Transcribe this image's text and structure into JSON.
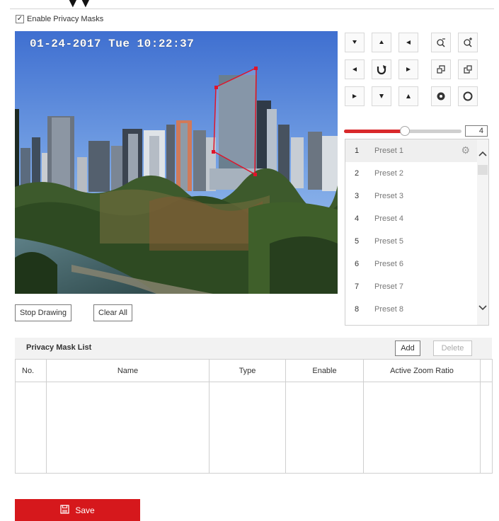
{
  "enable_privacy_masks": {
    "label": "Enable Privacy Masks",
    "checked": true
  },
  "video": {
    "osd_timestamp": "01-24-2017 Tue 10:22:37"
  },
  "ptz": {
    "buttons": [
      {
        "name": "pan-up-left",
        "icon": "arrow-up-left-icon"
      },
      {
        "name": "pan-up",
        "icon": "arrow-up-icon"
      },
      {
        "name": "pan-up-right",
        "icon": "arrow-up-right-icon"
      },
      {
        "name": "pan-left",
        "icon": "arrow-left-icon"
      },
      {
        "name": "auto-pan",
        "icon": "auto-rotate-icon"
      },
      {
        "name": "pan-right",
        "icon": "arrow-right-icon"
      },
      {
        "name": "pan-down-left",
        "icon": "arrow-down-left-icon"
      },
      {
        "name": "pan-down",
        "icon": "arrow-down-icon"
      },
      {
        "name": "pan-down-right",
        "icon": "arrow-down-right-icon"
      },
      {
        "name": "zoom-out",
        "icon": "zoom-out-icon"
      },
      {
        "name": "zoom-in",
        "icon": "zoom-in-icon"
      },
      {
        "name": "focus-near",
        "icon": "focus-near-icon"
      },
      {
        "name": "focus-far",
        "icon": "focus-far-icon"
      },
      {
        "name": "iris-close",
        "icon": "iris-close-icon"
      },
      {
        "name": "iris-open",
        "icon": "iris-open-icon"
      }
    ],
    "speed": {
      "value": "4",
      "level_fraction": 0.52,
      "accent": "#d9292b"
    }
  },
  "presets": {
    "items": [
      {
        "number": "1",
        "name": "Preset 1"
      },
      {
        "number": "2",
        "name": "Preset 2"
      },
      {
        "number": "3",
        "name": "Preset 3"
      },
      {
        "number": "4",
        "name": "Preset 4"
      },
      {
        "number": "5",
        "name": "Preset 5"
      },
      {
        "number": "6",
        "name": "Preset 6"
      },
      {
        "number": "7",
        "name": "Preset 7"
      },
      {
        "number": "8",
        "name": "Preset 8"
      }
    ],
    "active_index": 0
  },
  "drawing": {
    "stop_label": "Stop Drawing",
    "clear_label": "Clear All"
  },
  "mask_list": {
    "title": "Privacy Mask List",
    "add_label": "Add",
    "delete_label": "Delete",
    "columns": [
      "No.",
      "Name",
      "Type",
      "Enable",
      "Active Zoom Ratio",
      ""
    ]
  },
  "save": {
    "label": "Save",
    "color": "#d6181c",
    "icon": "save-icon"
  }
}
